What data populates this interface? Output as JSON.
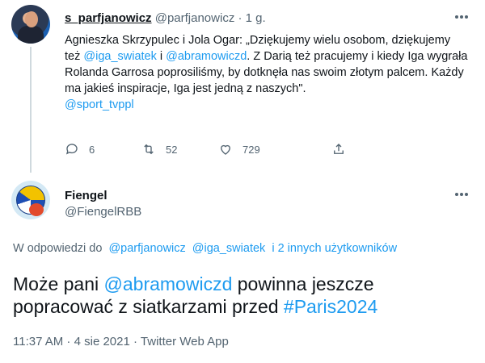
{
  "tweet1": {
    "display_name": "s_parfjanowicz",
    "handle": "@parfjanowicz",
    "separator": "·",
    "time": "1 g.",
    "body": {
      "text1": "Agnieszka Skrzypulec i Jola Ogar: „Dziękujemy wielu osobom, dziękujemy też ",
      "mention1": "@iga_swiatek",
      "text2": " i ",
      "mention2": "@abramowiczd",
      "text3": ". Z Darią też pracujemy i kiedy Iga wygrała Rolanda Garrosa poprosiliśmy, by dotknęła nas swoim złotym palcem. Każdy ma jakieś inspiracje, Iga jest jedną z naszych\".",
      "mention3": "@sport_tvppl"
    },
    "actions": {
      "replies": "6",
      "retweets": "52",
      "likes": "729"
    }
  },
  "tweet2": {
    "display_name": "Fiengel",
    "handle": "@FiengelRBB",
    "replying_prefix": "W odpowiedzi do",
    "replying_to": [
      "@parfjanowicz",
      "@iga_swiatek"
    ],
    "replying_more": "i 2 innych użytkowników",
    "text1": "Może pani ",
    "mention": "@abramowiczd",
    "text2": " powinna jeszcze popracować z siatkarzami przed ",
    "hashtag": "#Paris2024",
    "time": "11:37 AM",
    "date": "4 sie 2021",
    "source": "Twitter Web App",
    "sep": " · "
  },
  "colors": {
    "accent": "#1d9bf0",
    "muted": "#536471",
    "text": "#0f1419"
  },
  "icons": [
    "reply-icon",
    "retweet-icon",
    "like-icon",
    "share-icon",
    "more-icon"
  ]
}
